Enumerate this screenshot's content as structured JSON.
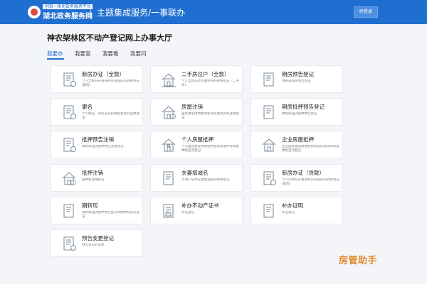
{
  "header": {
    "logo_sub": "全国一体化政务服务平台",
    "logo_main": "湖北政务服务网",
    "title": "主题集成服务/一事联办",
    "login_label": "码登录"
  },
  "page": {
    "title": "神农架林区不动产登记网上办事大厅"
  },
  "tabs": [
    {
      "label": "我要办",
      "active": true
    },
    {
      "label": "我要查",
      "active": false
    },
    {
      "label": "我要看",
      "active": false
    },
    {
      "label": "我要问",
      "active": false
    }
  ],
  "services": [
    {
      "name": "新房办证（全款）",
      "desc": "个人全款从开发商购买商品房的转移登记(新房)",
      "icon": "document-person-icon"
    },
    {
      "name": "二手房过户（全款）",
      "desc": "个人全款买卖存量住宅的转移登记（二手房）",
      "icon": "building-transfer-icon"
    },
    {
      "name": "期房预告登记",
      "desc": "预购商品房预告登记",
      "icon": "document-list-icon"
    },
    {
      "name": "更名",
      "desc": "个人姓名、身份证号码发生变化的变更登记",
      "icon": "document-person-icon"
    },
    {
      "name": "房屋注销",
      "desc": "国有建设用地使用权及房屋所有权注销登记",
      "icon": "house-cancel-icon"
    },
    {
      "name": "期房抵押预告登记",
      "desc": "预购商品房抵押预告登记",
      "icon": "document-list-icon"
    },
    {
      "name": "抵押预告注销",
      "desc": "预购商品房抵押预告注销登记",
      "icon": "document-cancel-icon"
    },
    {
      "name": "个人房屋抵押",
      "desc": "个人国有建设用地使用权及房屋所有权抵押权首次登记",
      "icon": "house-person-icon"
    },
    {
      "name": "企业房屋抵押",
      "desc": "企业国有建设用地使用权及房屋所有权抵押权首次登记",
      "icon": "house-building-icon"
    },
    {
      "name": "抵押注销",
      "desc": "抵押权注销登记",
      "icon": "house-cancel-icon"
    },
    {
      "name": "夫妻增减名",
      "desc": "不动产证书夫妻增减名的转移登记",
      "icon": "document-list-icon"
    },
    {
      "name": "新房办证（贷款）",
      "desc": "个人贷款从开发商购买商品房的转移登记(新房)",
      "icon": "document-person-icon"
    },
    {
      "name": "期转现",
      "desc": "预购商品房抵押预告登记转抵押权首次登记",
      "icon": "document-list-icon"
    },
    {
      "name": "补办不动产证书",
      "desc": "补证登记",
      "icon": "document-image-icon"
    },
    {
      "name": "补办证明",
      "desc": "补证登记",
      "icon": "document-list-icon"
    },
    {
      "name": "预告变更登记",
      "desc": "预告登记的变更",
      "icon": "document-person-icon"
    }
  ],
  "watermark": "房管助手",
  "colors": {
    "header": "#1f6fd1",
    "accent": "#1f6fd1",
    "watermark": "#e38a2a"
  }
}
